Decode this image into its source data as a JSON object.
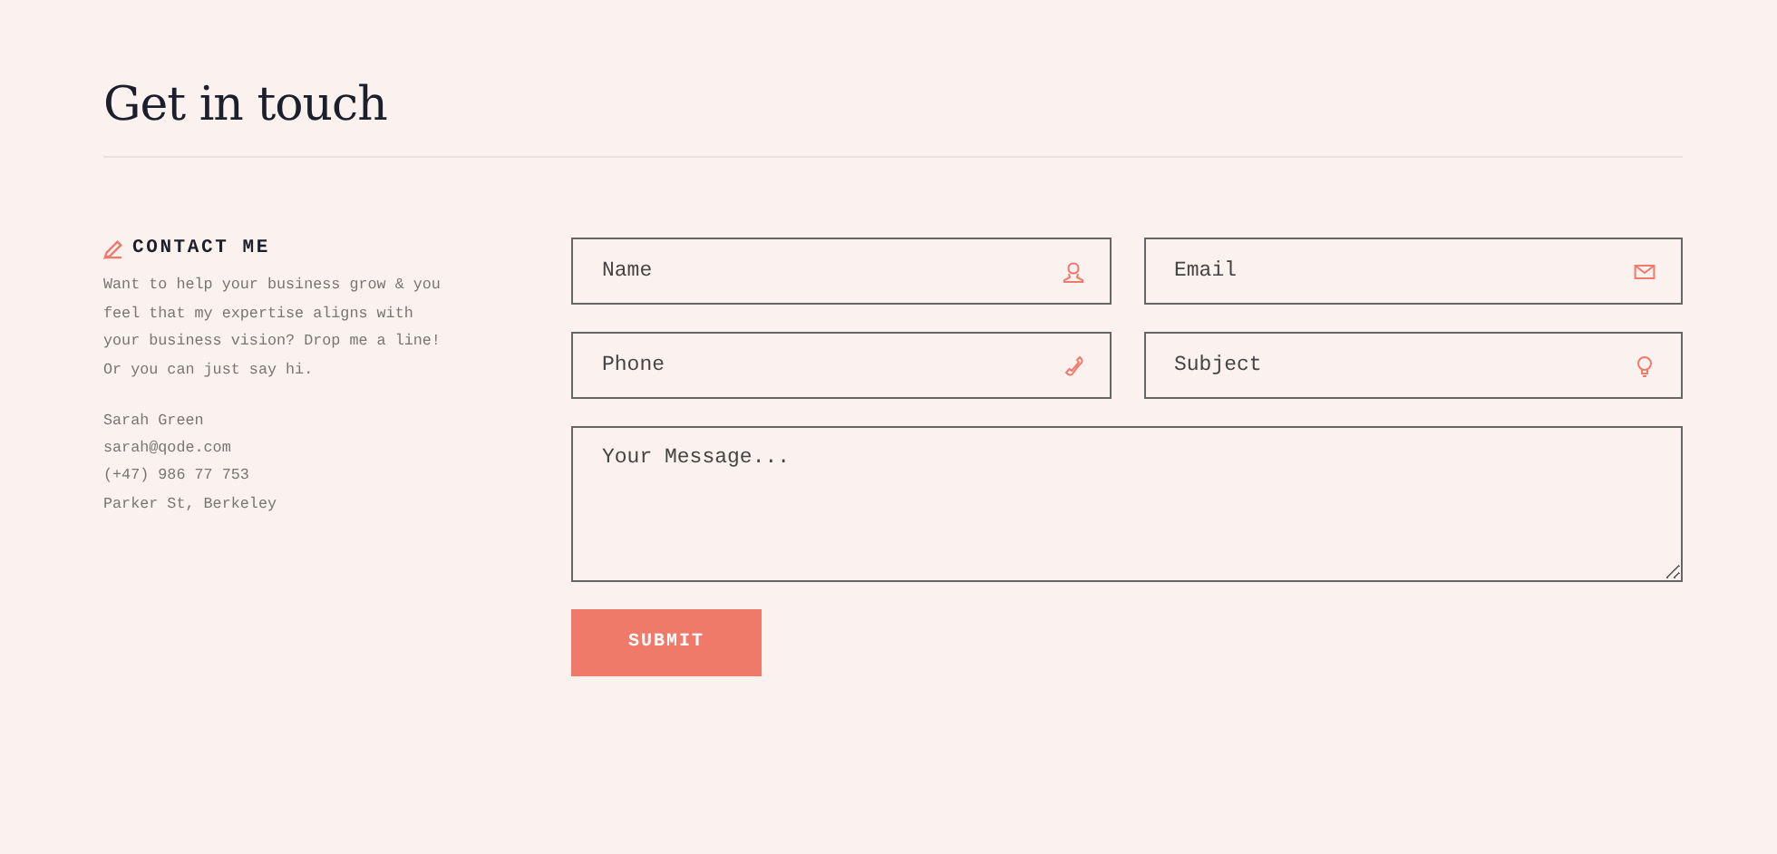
{
  "heading": "Get in touch",
  "contact": {
    "title": "CONTACT ME",
    "text": "Want to help your business grow & you feel that my expertise aligns with your business vision? Drop me a line! Or you can just say hi.",
    "details": [
      "Sarah Green",
      "sarah@qode.com",
      "(+47) 986 77 753",
      "Parker St, Berkeley"
    ]
  },
  "form": {
    "fields": [
      {
        "placeholder": "Name",
        "kind": "person"
      },
      {
        "placeholder": "Email",
        "kind": "mail"
      },
      {
        "placeholder": "Phone",
        "kind": "phone"
      },
      {
        "placeholder": "Subject",
        "kind": "bulb"
      }
    ],
    "message": {
      "placeholder": "Your Message..."
    },
    "submit": "SUBMIT"
  }
}
